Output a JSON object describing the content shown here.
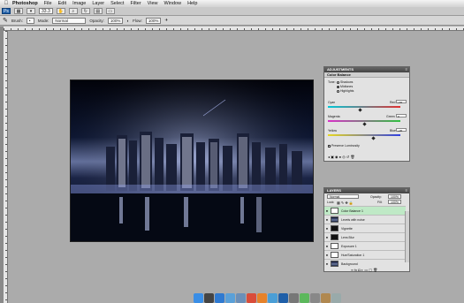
{
  "menubar": {
    "apple_icon": "apple-icon",
    "app_name": "Photoshop",
    "items": [
      "File",
      "Edit",
      "Image",
      "Layer",
      "Select",
      "Filter",
      "View",
      "Window",
      "Help"
    ]
  },
  "appbar": {
    "ps_label": "Ps",
    "zoom": "33.3"
  },
  "options": {
    "brush_label": "Brush:",
    "mode_label": "Mode:",
    "mode_value": "Normal",
    "opacity_label": "Opacity:",
    "opacity_value": "100%",
    "flow_label": "Flow:",
    "flow_value": "100%"
  },
  "adjustments": {
    "title": "ADJUSTMENTS",
    "subtitle": "Color Balance",
    "tone_label": "Tone:",
    "tones": [
      "Shadows",
      "Midtones",
      "Highlights"
    ],
    "selected_tone": "Midtones",
    "sliders": [
      {
        "left": "Cyan",
        "right": "Red",
        "value": "+15",
        "position": 0.45
      },
      {
        "left": "Magenta",
        "right": "Green",
        "value": "0",
        "position": 0.5
      },
      {
        "left": "Yellow",
        "right": "Blue",
        "value": "+26",
        "position": 0.63
      }
    ],
    "preserve_label": "Preserve Luminosity",
    "preserve_checked": true
  },
  "layers": {
    "title": "LAYERS",
    "blend_mode": "Normal",
    "opacity_label": "Opacity:",
    "opacity_value": "100%",
    "lock_label": "Lock:",
    "fill_label": "Fill:",
    "fill_value": "100%",
    "items": [
      {
        "name": "Color Balance 1",
        "thumb": "white",
        "selected": true
      },
      {
        "name": "Levels with noise",
        "thumb": "photo",
        "selected": false
      },
      {
        "name": "Vignette",
        "thumb": "dark",
        "selected": false
      },
      {
        "name": "Lens Blur",
        "thumb": "dark",
        "selected": false
      },
      {
        "name": "Exposure 1",
        "thumb": "white",
        "selected": false
      },
      {
        "name": "Hue/Saturation 1",
        "thumb": "white",
        "selected": false
      },
      {
        "name": "Background",
        "thumb": "photo",
        "selected": false
      }
    ]
  },
  "dock": {
    "icons": [
      "finder-icon",
      "dashboard-icon",
      "safari-icon",
      "itunes-icon",
      "mail-icon",
      "ical-icon",
      "firefox-icon",
      "preview-icon",
      "photoshop-icon",
      "calculator-icon",
      "ichat-icon",
      "system-preferences-icon",
      "documents-stack-icon",
      "trash-icon"
    ],
    "colors": [
      "#3a8ee6",
      "#444",
      "#2f7ad1",
      "#5aa0d8",
      "#6b8fb8",
      "#d94c3a",
      "#e6822a",
      "#4a9ed6",
      "#1f5fa8",
      "#777",
      "#5cb85c",
      "#888",
      "#b08850",
      "#9aa"
    ]
  }
}
